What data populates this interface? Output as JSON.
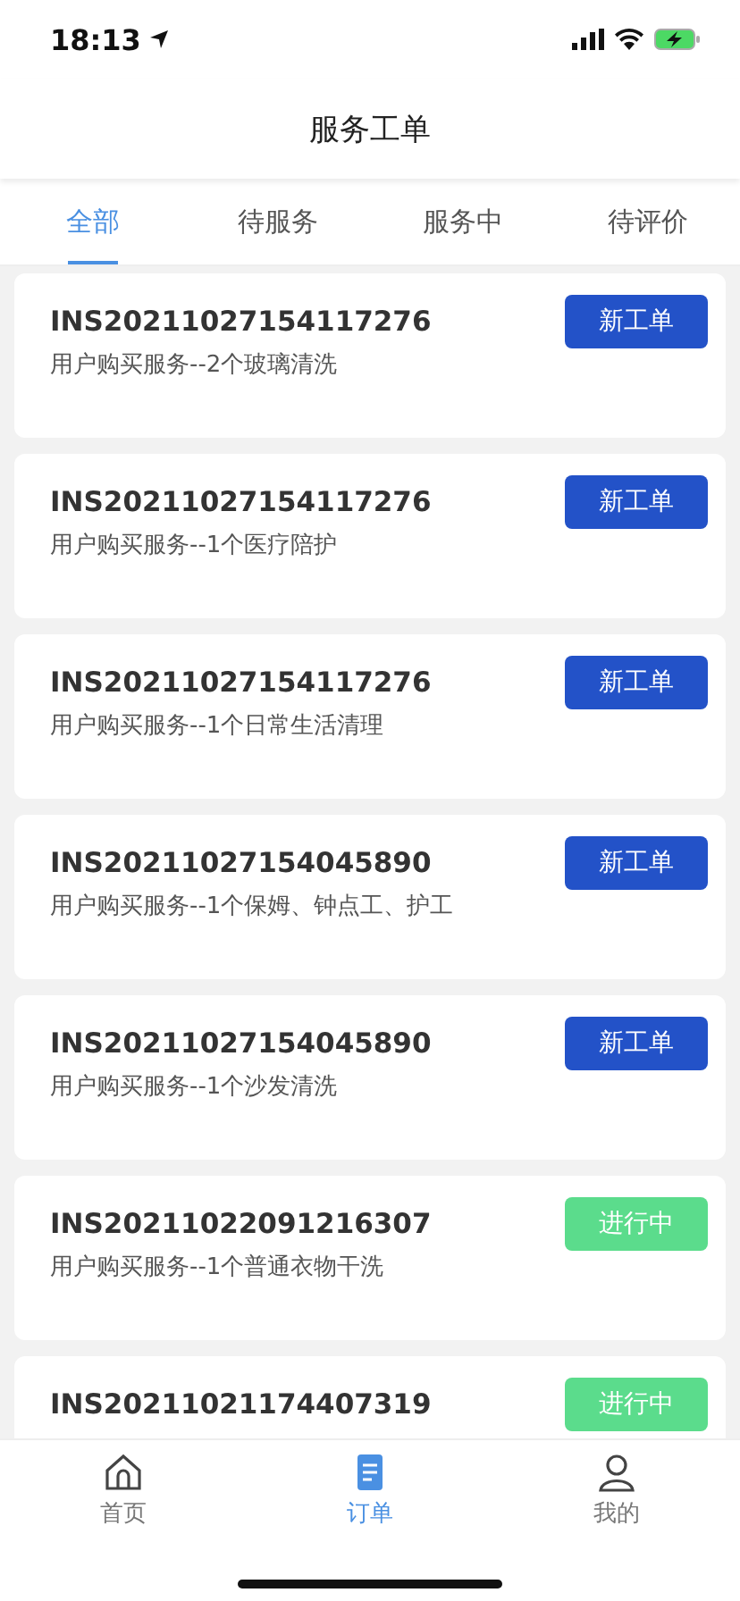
{
  "status_bar": {
    "time": "18:13"
  },
  "header": {
    "title": "服务工单"
  },
  "tabs": [
    {
      "label": "全部",
      "selected": true
    },
    {
      "label": "待服务",
      "selected": false
    },
    {
      "label": "服务中",
      "selected": false
    },
    {
      "label": "待评价",
      "selected": false
    }
  ],
  "orders": [
    {
      "id": "INS20211027154117276",
      "description": "用户购买服务--2个玻璃清洗",
      "status": {
        "kind": "new",
        "label": "新工单"
      }
    },
    {
      "id": "INS20211027154117276",
      "description": "用户购买服务--1个医疗陪护",
      "status": {
        "kind": "new",
        "label": "新工单"
      }
    },
    {
      "id": "INS20211027154117276",
      "description": "用户购买服务--1个日常生活清理",
      "status": {
        "kind": "new",
        "label": "新工单"
      }
    },
    {
      "id": "INS20211027154045890",
      "description": "用户购买服务--1个保姆、钟点工、护工",
      "status": {
        "kind": "new",
        "label": "新工单"
      }
    },
    {
      "id": "INS20211027154045890",
      "description": "用户购买服务--1个沙发清洗",
      "status": {
        "kind": "new",
        "label": "新工单"
      }
    },
    {
      "id": "INS20211022091216307",
      "description": "用户购买服务--1个普通衣物干洗",
      "status": {
        "kind": "in_progress",
        "label": "进行中"
      }
    },
    {
      "id": "INS20211021174407319",
      "status": {
        "kind": "in_progress",
        "label": "进行中"
      }
    }
  ],
  "bottom_nav": [
    {
      "kind": "home",
      "label": "首页",
      "selected": false
    },
    {
      "kind": "orders",
      "label": "订单",
      "selected": true
    },
    {
      "kind": "profile",
      "label": "我的",
      "selected": false
    }
  ]
}
